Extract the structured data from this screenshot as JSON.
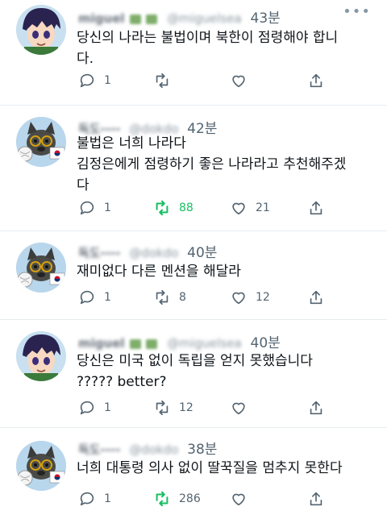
{
  "tweets": [
    {
      "user_name": "miguel",
      "handle": "@miguelsea",
      "time": "43분",
      "lines": [
        "당신의 나라는 불법이며 북한이 점령해야 합니",
        "다."
      ],
      "replies": "1",
      "retweets": "",
      "likes": "",
      "avatar": "anime-boy",
      "retweeted": false
    },
    {
      "user_name": "독도----",
      "handle": "@dokdo",
      "time": "42분",
      "lines": [
        "불법은 너희 나라다",
        "김정은에게 점령하기 좋은 나라라고 추천해주겠",
        "다"
      ],
      "replies": "1",
      "retweets": "88",
      "likes": "21",
      "avatar": "dog-flag",
      "retweeted": true
    },
    {
      "user_name": "독도----",
      "handle": "@dokdo",
      "time": "40분",
      "lines": [
        "재미없다 다른 멘션을 해달라"
      ],
      "replies": "1",
      "retweets": "8",
      "likes": "12",
      "avatar": "dog-flag",
      "retweeted": false
    },
    {
      "user_name": "miguel",
      "handle": "@miguelsea",
      "time": "40분",
      "lines": [
        "당신은 미국 없이 독립을 얻지 못했습니다",
        "????? better?"
      ],
      "replies": "1",
      "retweets": "12",
      "likes": "",
      "avatar": "anime-boy",
      "retweeted": false
    },
    {
      "user_name": "독도----",
      "handle": "@dokdo",
      "time": "38분",
      "lines": [
        "너희 대통령 의사 없이 딸꾹질을 멈추지 못한다"
      ],
      "replies": "1",
      "retweets": "286",
      "likes": "",
      "avatar": "dog-flag",
      "retweeted": true
    }
  ],
  "colors": {
    "retweet_active": "#17bf63",
    "icon_gray": "#536471",
    "divider": "#e6ecf0"
  }
}
